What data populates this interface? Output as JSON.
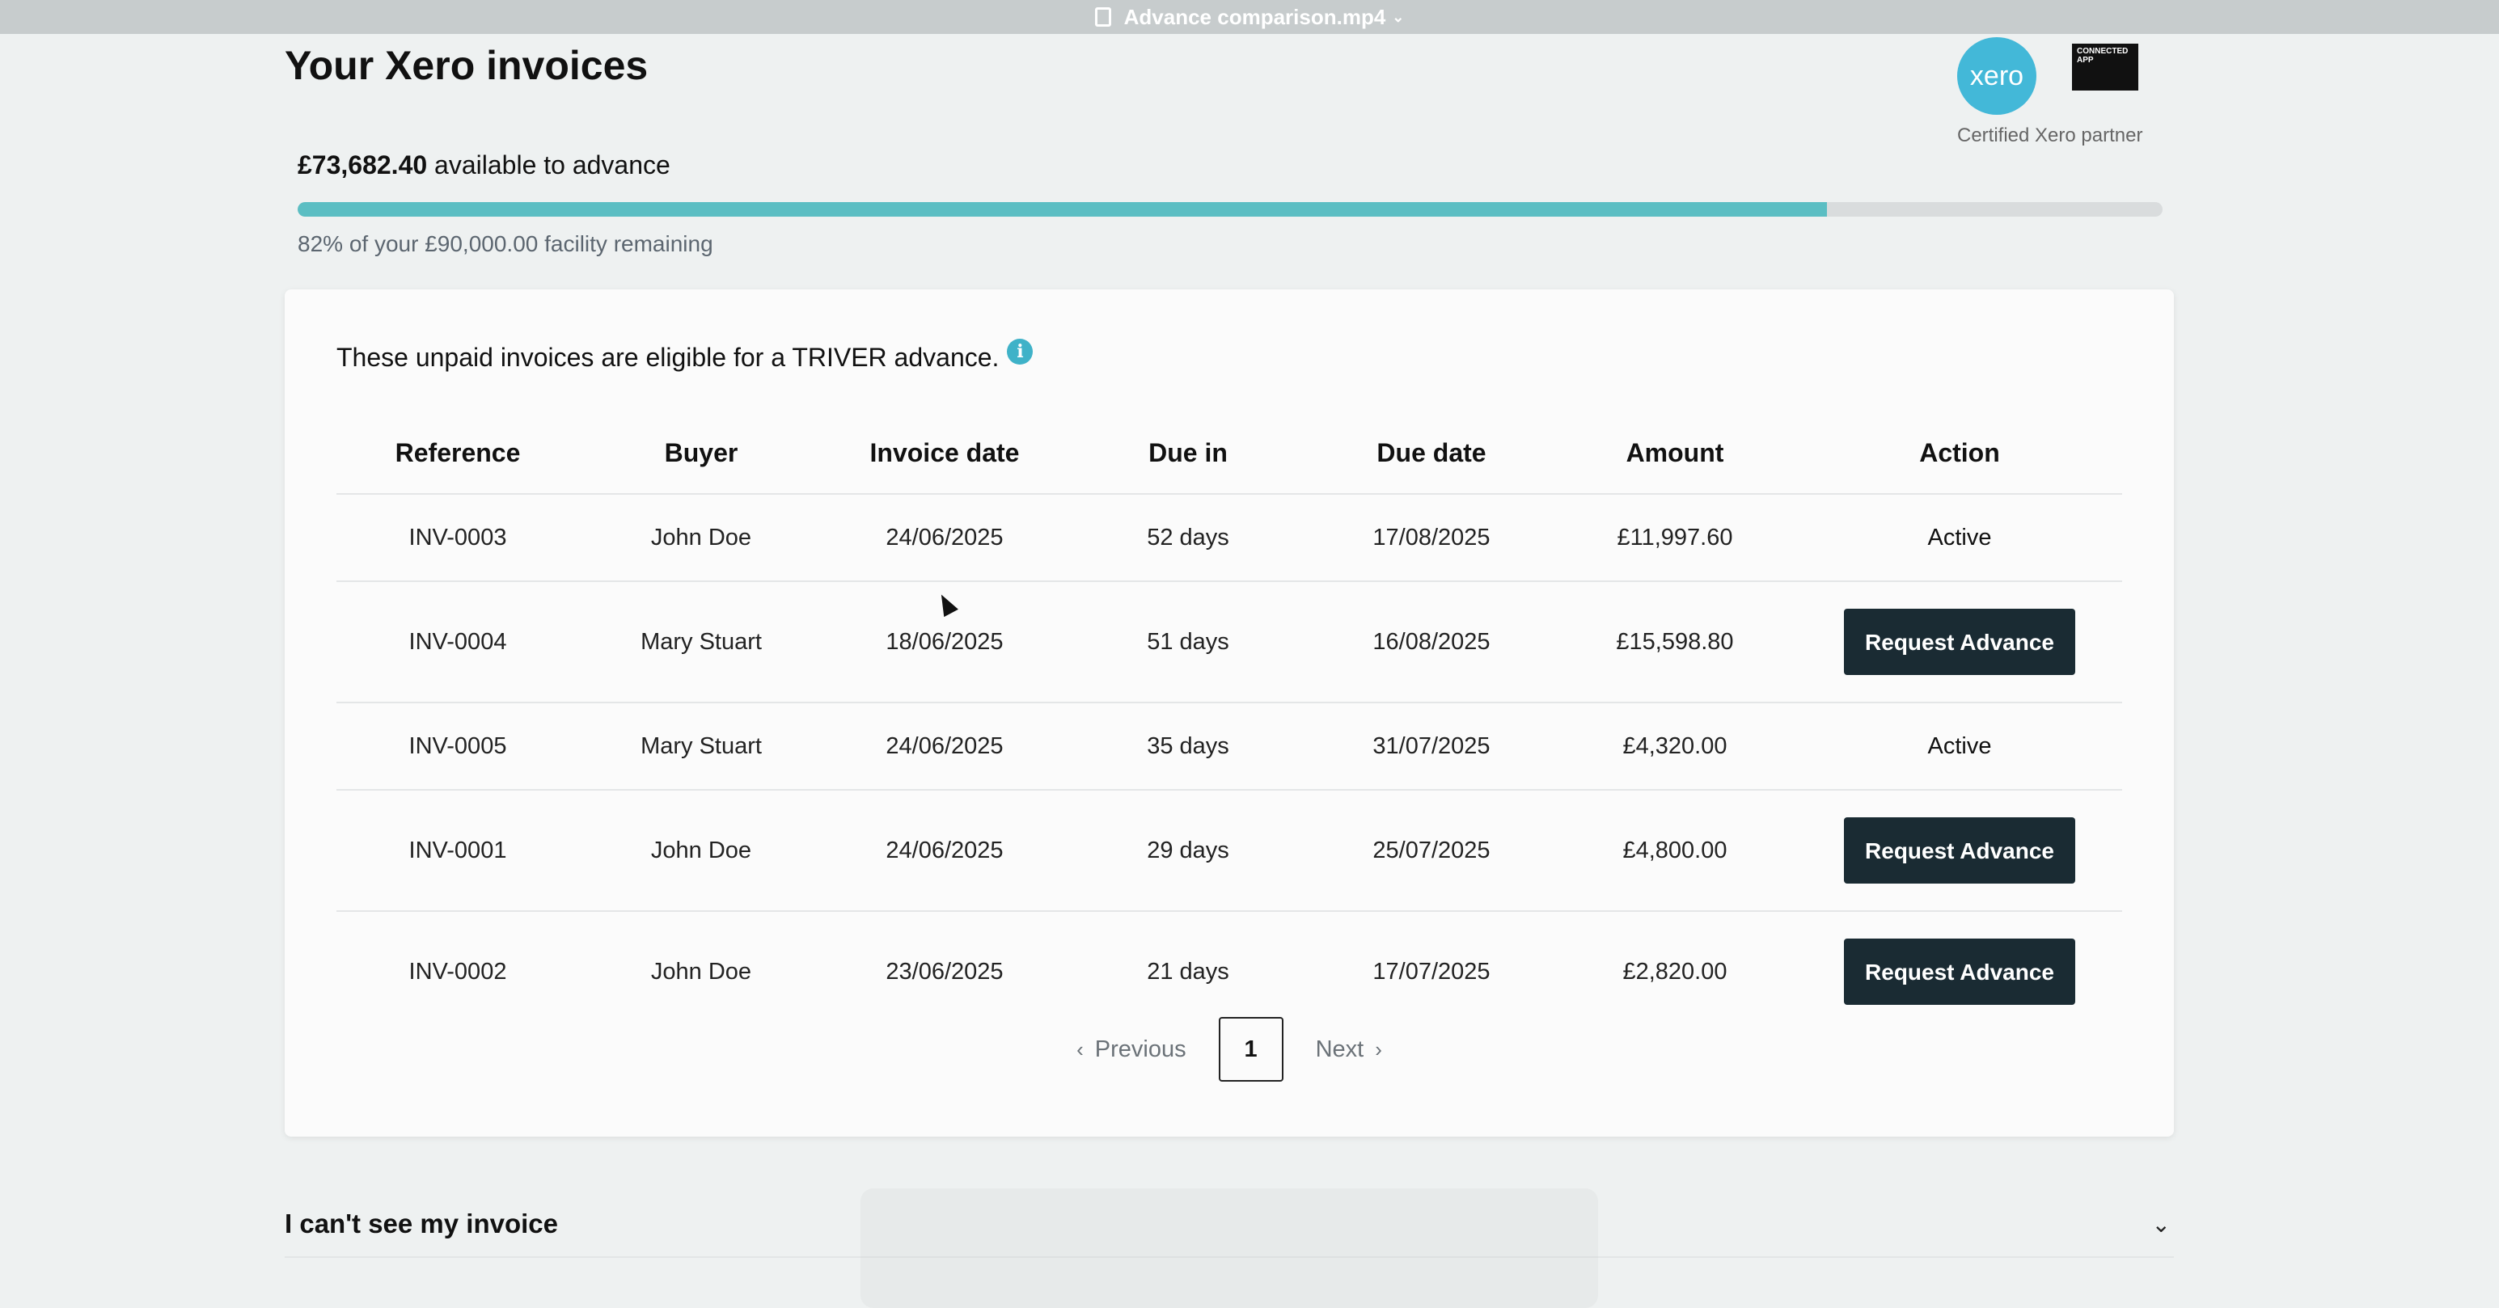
{
  "window": {
    "title": "Advance comparison.mp4"
  },
  "page": {
    "title": "Your Xero invoices"
  },
  "partner": {
    "logo_text": "xero",
    "badge_text": "CONNECTED APP",
    "label": "Certified Xero partner"
  },
  "facility": {
    "available_amount": "£73,682.40",
    "available_text": "available to advance",
    "remaining_text": "82% of your £90,000.00 facility remaining",
    "remaining_fraction": 0.82
  },
  "invoices_card": {
    "intro": "These unpaid invoices are eligible for a TRIVER advance.",
    "columns": [
      "Reference",
      "Buyer",
      "Invoice date",
      "Due in",
      "Due date",
      "Amount",
      "Action"
    ],
    "rows": [
      {
        "reference": "INV-0003",
        "buyer": "John Doe",
        "invoice_date": "24/06/2025",
        "due_in": "52 days",
        "due_date": "17/08/2025",
        "amount": "£11,997.60",
        "action": "Active",
        "action_type": "status"
      },
      {
        "reference": "INV-0004",
        "buyer": "Mary Stuart",
        "invoice_date": "18/06/2025",
        "due_in": "51 days",
        "due_date": "16/08/2025",
        "amount": "£15,598.80",
        "action": "Request Advance",
        "action_type": "button"
      },
      {
        "reference": "INV-0005",
        "buyer": "Mary Stuart",
        "invoice_date": "24/06/2025",
        "due_in": "35 days",
        "due_date": "31/07/2025",
        "amount": "£4,320.00",
        "action": "Active",
        "action_type": "status"
      },
      {
        "reference": "INV-0001",
        "buyer": "John Doe",
        "invoice_date": "24/06/2025",
        "due_in": "29 days",
        "due_date": "25/07/2025",
        "amount": "£4,800.00",
        "action": "Request Advance",
        "action_type": "button"
      },
      {
        "reference": "INV-0002",
        "buyer": "John Doe",
        "invoice_date": "23/06/2025",
        "due_in": "21 days",
        "due_date": "17/07/2025",
        "amount": "£2,820.00",
        "action": "Request Advance",
        "action_type": "button"
      }
    ],
    "pagination": {
      "previous_label": "Previous",
      "current_page": "1",
      "next_label": "Next"
    }
  },
  "faq": {
    "question": "I can't see my invoice"
  },
  "colors": {
    "progress_fill": "#5bbec3",
    "button_bg": "#1a2b33",
    "xero_blue": "#43b8d8"
  }
}
